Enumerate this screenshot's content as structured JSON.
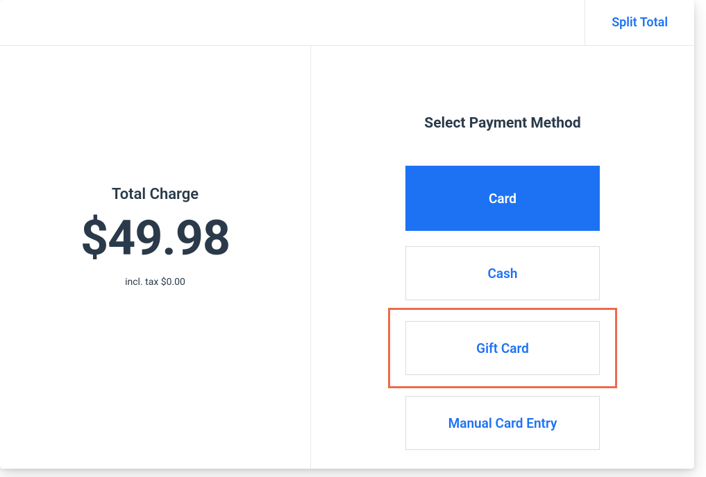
{
  "header": {
    "split_total": "Split Total"
  },
  "left": {
    "total_label": "Total Charge",
    "total_amount": "$49.98",
    "tax_note": "incl. tax $0.00"
  },
  "right": {
    "title": "Select Payment Method",
    "options": {
      "card": "Card",
      "cash": "Cash",
      "gift_card": "Gift Card",
      "manual_entry": "Manual Card Entry"
    }
  }
}
